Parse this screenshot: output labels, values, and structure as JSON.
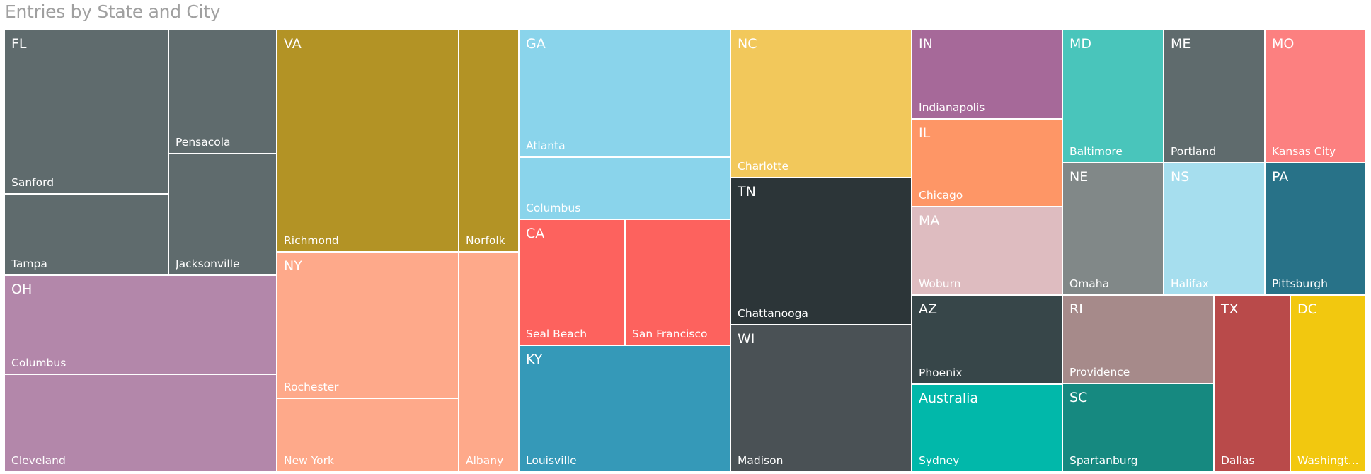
{
  "chart_data": {
    "type": "treemap",
    "title": "Entries by State and City",
    "value_note": "Relative entry counts estimated from tile areas (no values printed)",
    "groups": [
      {
        "state": "FL",
        "color": "#5F6B6D",
        "cities": [
          {
            "name": "Sanford",
            "value": 2
          },
          {
            "name": "Tampa",
            "value": 1
          },
          {
            "name": "Pensacola",
            "value": 1
          },
          {
            "name": "Jacksonville",
            "value": 1
          }
        ]
      },
      {
        "state": "OH",
        "color": "#B387AA",
        "cities": [
          {
            "name": "Columbus",
            "value": 2
          },
          {
            "name": "Cleveland",
            "value": 2
          }
        ]
      },
      {
        "state": "VA",
        "color": "#B39325",
        "cities": [
          {
            "name": "Richmond",
            "value": 3
          },
          {
            "name": "Norfolk",
            "value": 1
          }
        ]
      },
      {
        "state": "NY",
        "color": "#FEA98A",
        "cities": [
          {
            "name": "Rochester",
            "value": 2
          },
          {
            "name": "New York",
            "value": 1
          },
          {
            "name": "Albany",
            "value": 1
          }
        ]
      },
      {
        "state": "GA",
        "color": "#8AD4EB",
        "cities": [
          {
            "name": "Atlanta",
            "value": 2
          },
          {
            "name": "Columbus",
            "value": 1
          }
        ]
      },
      {
        "state": "CA",
        "color": "#FD625E",
        "cities": [
          {
            "name": "Seal Beach",
            "value": 1
          },
          {
            "name": "San Francisco",
            "value": 1
          }
        ]
      },
      {
        "state": "KY",
        "color": "#3599B8",
        "cities": [
          {
            "name": "Louisville",
            "value": 2
          }
        ]
      },
      {
        "state": "NC",
        "color": "#F2C85B",
        "cities": [
          {
            "name": "Charlotte",
            "value": 2
          }
        ]
      },
      {
        "state": "TN",
        "color": "#2C3538",
        "cities": [
          {
            "name": "Chattanooga",
            "value": 2
          }
        ]
      },
      {
        "state": "WI",
        "color": "#4A5155",
        "cities": [
          {
            "name": "Madison",
            "value": 2
          }
        ]
      },
      {
        "state": "IN",
        "color": "#A66999",
        "cities": [
          {
            "name": "Indianapolis",
            "value": 1
          }
        ]
      },
      {
        "state": "IL",
        "color": "#FE9666",
        "cities": [
          {
            "name": "Chicago",
            "value": 1
          }
        ]
      },
      {
        "state": "MA",
        "color": "#DEBCC0",
        "cities": [
          {
            "name": "Woburn",
            "value": 1
          }
        ]
      },
      {
        "state": "AZ",
        "color": "#374649",
        "cities": [
          {
            "name": "Phoenix",
            "value": 1
          }
        ]
      },
      {
        "state": "Australia",
        "color": "#01B8AA",
        "cities": [
          {
            "name": "Sydney",
            "value": 1
          }
        ]
      },
      {
        "state": "MD",
        "color": "#49C5BB",
        "cities": [
          {
            "name": "Baltimore",
            "value": 1
          }
        ]
      },
      {
        "state": "ME",
        "color": "#5F6B6D",
        "cities": [
          {
            "name": "Portland",
            "value": 1
          }
        ]
      },
      {
        "state": "MO",
        "color": "#FC8080",
        "cities": [
          {
            "name": "Kansas City",
            "value": 1
          }
        ]
      },
      {
        "state": "NE",
        "color": "#818888",
        "cities": [
          {
            "name": "Omaha",
            "value": 1
          }
        ]
      },
      {
        "state": "NS",
        "color": "#A6DEEE",
        "cities": [
          {
            "name": "Halifax",
            "value": 1
          }
        ]
      },
      {
        "state": "PA",
        "color": "#287288",
        "cities": [
          {
            "name": "Pittsburgh",
            "value": 1
          }
        ]
      },
      {
        "state": "RI",
        "color": "#A68A8A",
        "cities": [
          {
            "name": "Providence",
            "value": 1
          }
        ]
      },
      {
        "state": "SC",
        "color": "#168980",
        "cities": [
          {
            "name": "Spartanburg",
            "value": 1
          }
        ]
      },
      {
        "state": "TX",
        "color": "#B94A4A",
        "cities": [
          {
            "name": "Dallas",
            "value": 1
          }
        ]
      },
      {
        "state": "DC",
        "color": "#F2C80F",
        "cities": [
          {
            "name": "Washingt...",
            "value": 1
          }
        ]
      }
    ]
  }
}
